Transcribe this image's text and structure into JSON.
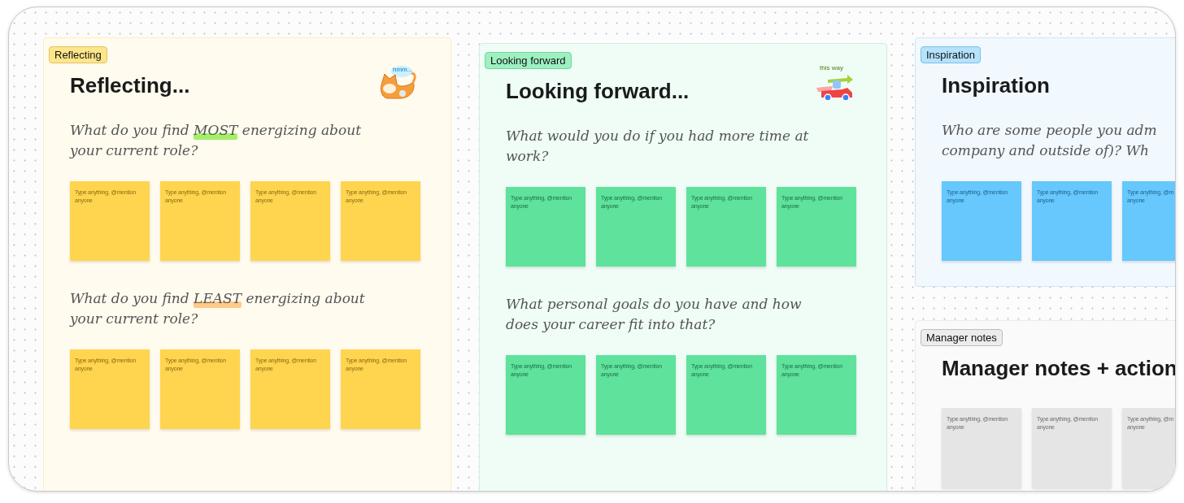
{
  "sections": [
    {
      "tag": "Reflecting",
      "title": "Reflecting...",
      "color": "#ffd54f",
      "sticker_caption": "hmm...",
      "blocks": [
        {
          "question": [
            [
              {
                "text": "What do you find "
              },
              {
                "text": "MOST",
                "color": "#a3ef6b"
              },
              {
                "text": " energizing about"
              }
            ],
            [
              {
                "text": "your current role?"
              }
            ]
          ],
          "notes": [
            {
              "placeholder_lines": [
                "Type anything, @mention",
                "anyone"
              ]
            },
            {
              "placeholder_lines": [
                "Type anything, @mention",
                "anyone"
              ]
            },
            {
              "placeholder_lines": [
                "Type anything, @mention",
                "anyone"
              ]
            },
            {
              "placeholder_lines": [
                "Type anything, @mention",
                "anyone"
              ]
            }
          ]
        },
        {
          "question": [
            [
              {
                "text": "What do you find "
              },
              {
                "text": "LEAST",
                "color": "#ffc98a"
              },
              {
                "text": " energizing about"
              }
            ],
            [
              {
                "text": "your current role?"
              }
            ]
          ],
          "notes": [
            {
              "placeholder_lines": [
                "Type anything, @mention",
                "anyone"
              ]
            },
            {
              "placeholder_lines": [
                "Type anything, @mention",
                "anyone"
              ]
            },
            {
              "placeholder_lines": [
                "Type anything, @mention",
                "anyone"
              ]
            },
            {
              "placeholder_lines": [
                "Type anything, @mention",
                "anyone"
              ]
            }
          ]
        }
      ]
    },
    {
      "tag": "Looking forward",
      "title": "Looking forward...",
      "color": "#5fe29b",
      "sticker_caption": "this way",
      "blocks": [
        {
          "question": [
            [
              {
                "text": "What would you do if you had more time at"
              }
            ],
            [
              {
                "text": "work?"
              }
            ]
          ],
          "notes": [
            {
              "placeholder_lines": [
                "Type anything, @mention",
                "anyone"
              ]
            },
            {
              "placeholder_lines": [
                "Type anything, @mention",
                "anyone"
              ]
            },
            {
              "placeholder_lines": [
                "Type anything, @mention",
                "anyone"
              ]
            },
            {
              "placeholder_lines": [
                "Type anything, @mention",
                "anyone"
              ]
            }
          ]
        },
        {
          "question": [
            [
              {
                "text": "What personal goals do you have and how"
              }
            ],
            [
              {
                "text": "does your career fit into that?"
              }
            ]
          ],
          "notes": [
            {
              "placeholder_lines": [
                "Type anything, @mention",
                "anyone"
              ]
            },
            {
              "placeholder_lines": [
                "Type anything, @mention",
                "anyone"
              ]
            },
            {
              "placeholder_lines": [
                "Type anything, @mention",
                "anyone"
              ]
            },
            {
              "placeholder_lines": [
                "Type anything, @mention",
                "anyone"
              ]
            }
          ]
        }
      ]
    },
    {
      "tag": "Inspiration",
      "title": "Inspiration",
      "color": "#66c8fc",
      "blocks": [
        {
          "question": [
            [
              {
                "text": "Who are some people you adm"
              }
            ],
            [
              {
                "text": "company and outside of)? Wh"
              }
            ]
          ],
          "notes": [
            {
              "placeholder_lines": [
                "Type anything, @mention",
                "anyone"
              ]
            },
            {
              "placeholder_lines": [
                "Type anything, @mention",
                "anyone"
              ]
            },
            {
              "placeholder_lines": [
                "Type anything, @m",
                "anyone"
              ]
            }
          ]
        }
      ]
    },
    {
      "tag": "Manager notes",
      "title": "Manager notes + action",
      "color": "#e5e5e5",
      "blocks": [
        {
          "notes": [
            {
              "placeholder_lines": [
                "Type anything, @mention",
                "anyone"
              ]
            },
            {
              "placeholder_lines": [
                "Type anything, @mention",
                "anyone"
              ]
            },
            {
              "placeholder_lines": [
                "Type anything, @m",
                "anyone"
              ]
            }
          ]
        }
      ]
    }
  ]
}
